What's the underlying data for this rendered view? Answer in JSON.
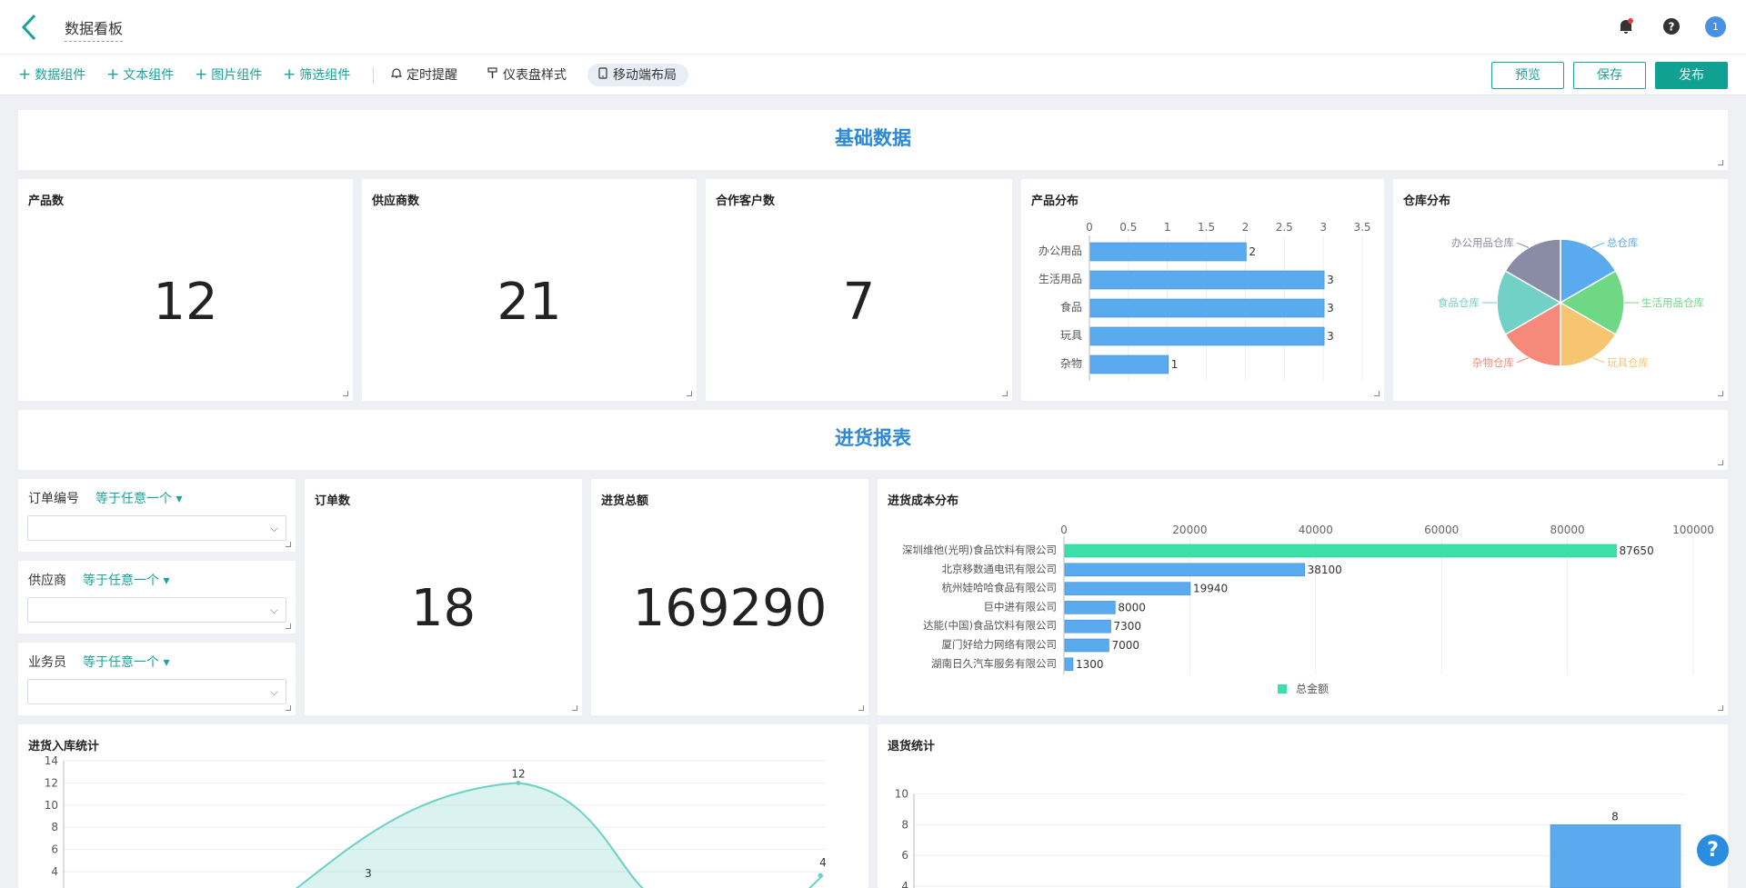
{
  "header": {
    "title": "数据看板",
    "avatar": "1"
  },
  "toolbar": {
    "add_data": "数据组件",
    "add_text": "文本组件",
    "add_image": "图片组件",
    "add_filter": "筛选组件",
    "reminder": "定时提醒",
    "style": "仪表盘样式",
    "mobile": "移动端布局",
    "preview": "预览",
    "save": "保存",
    "publish": "发布"
  },
  "sections": {
    "basic": "基础数据",
    "purchase": "进货报表"
  },
  "kpis": {
    "products": {
      "label": "产品数",
      "value": "12"
    },
    "suppliers": {
      "label": "供应商数",
      "value": "21"
    },
    "customers": {
      "label": "合作客户数",
      "value": "7"
    },
    "orders": {
      "label": "订单数",
      "value": "18"
    },
    "total": {
      "label": "进货总额",
      "value": "169290"
    }
  },
  "filters": [
    {
      "label": "订单编号",
      "op": "等于任意一个"
    },
    {
      "label": "供应商",
      "op": "等于任意一个"
    },
    {
      "label": "业务员",
      "op": "等于任意一个"
    }
  ],
  "titles": {
    "product_dist": "产品分布",
    "warehouse_dist": "仓库分布",
    "cost_dist": "进货成本分布",
    "inbound": "进货入库统计",
    "returns": "退货统计"
  },
  "chart_data": [
    {
      "type": "bar",
      "orientation": "horizontal",
      "title": "产品分布",
      "categories": [
        "办公用品",
        "生活用品",
        "食品",
        "玩具",
        "杂物"
      ],
      "values": [
        2,
        3,
        3,
        3,
        1
      ],
      "xlim": [
        0,
        3.5
      ],
      "xticks": [
        0,
        0.5,
        1,
        1.5,
        2,
        2.5,
        3,
        3.5
      ],
      "color": "#5aaaf0"
    },
    {
      "type": "pie",
      "title": "仓库分布",
      "labels": [
        "总仓库",
        "生活用品仓库",
        "玩具仓库",
        "杂物仓库",
        "食品仓库",
        "办公用品仓库"
      ],
      "values": [
        1,
        1,
        1,
        1,
        1,
        1
      ],
      "colors": [
        "#5aaaf0",
        "#6fd885",
        "#f7c46f",
        "#f58a7a",
        "#72d1c6",
        "#8a8ca6"
      ]
    },
    {
      "type": "bar",
      "orientation": "horizontal",
      "title": "进货成本分布",
      "categories": [
        "深圳维他(光明)食品饮料有限公司",
        "北京移数通电讯有限公司",
        "杭州娃哈哈食品有限公司",
        "巨中进有限公司",
        "达能(中国)食品饮料有限公司",
        "厦门好给力网络有限公司",
        "湖南日久汽车服务有限公司"
      ],
      "values": [
        87650,
        38100,
        19940,
        8000,
        7300,
        7000,
        1300
      ],
      "xlim": [
        0,
        100000
      ],
      "xticks": [
        0,
        20000,
        40000,
        60000,
        80000,
        100000
      ],
      "legend": "总金额",
      "colors": [
        "#3be0a8",
        "#5aaaf0"
      ]
    },
    {
      "type": "area",
      "title": "进货入库统计",
      "yticks": [
        4,
        6,
        8,
        10,
        12,
        14
      ],
      "point_labels": [
        {
          "label": "3",
          "value": 3
        },
        {
          "label": "12",
          "value": 12
        },
        {
          "label": "4",
          "value": 4
        }
      ],
      "color": "#6cd1c4"
    },
    {
      "type": "bar",
      "title": "退货统计",
      "yticks": [
        4,
        6,
        8,
        10
      ],
      "values": [
        8
      ],
      "point_label": "8",
      "color": "#5aaaf0"
    }
  ]
}
